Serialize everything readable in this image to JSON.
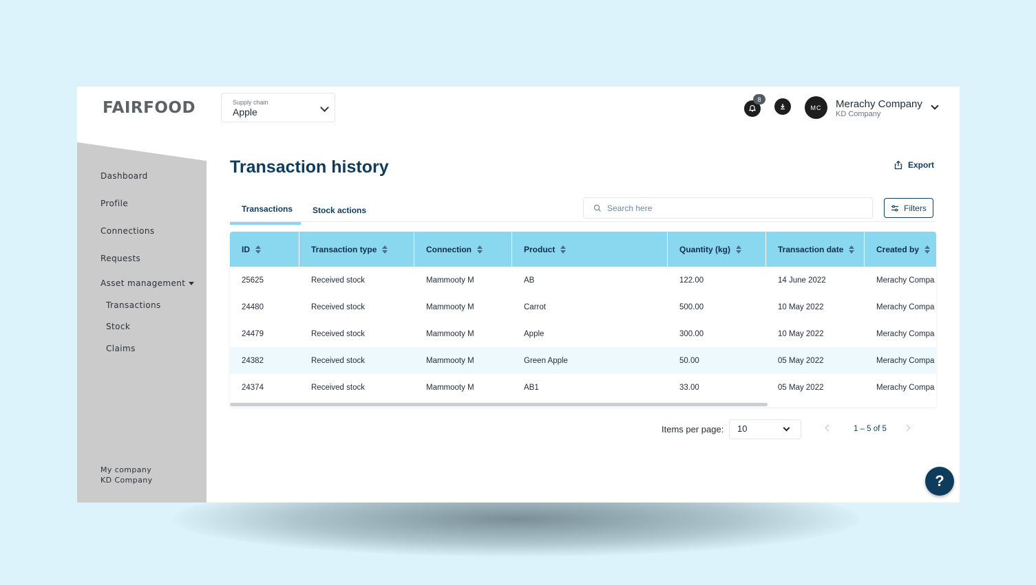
{
  "app": {
    "logo": "FAIRFOOD"
  },
  "supply_chain": {
    "label": "Supply chain",
    "value": "Apple"
  },
  "header": {
    "notification_count": "8",
    "avatar_initials": "MC",
    "user_name": "Merachy Company",
    "user_company": "KD Company"
  },
  "sidebar": {
    "items": [
      {
        "label": "Dashboard"
      },
      {
        "label": "Profile"
      },
      {
        "label": "Connections"
      },
      {
        "label": "Requests"
      },
      {
        "label": "Asset management"
      }
    ],
    "sub_items": [
      {
        "label": "Transactions"
      },
      {
        "label": "Stock"
      },
      {
        "label": "Claims"
      }
    ],
    "bottom": {
      "label": "My company",
      "company": "KD Company"
    }
  },
  "page": {
    "title": "Transaction history",
    "export_label": "Export"
  },
  "tabs": [
    {
      "label": "Transactions"
    },
    {
      "label": "Stock actions"
    }
  ],
  "search": {
    "placeholder": "Search here"
  },
  "filters_label": "Filters",
  "table": {
    "columns": [
      "ID",
      "Transaction type",
      "Connection",
      "Product",
      "Quantity (kg)",
      "Transaction date",
      "Created by"
    ],
    "rows": [
      [
        "25625",
        "Received stock",
        "Mammooty M",
        "AB",
        "122.00",
        "14 June 2022",
        "Merachy Compa"
      ],
      [
        "24480",
        "Received stock",
        "Mammooty M",
        "Carrot",
        "500.00",
        "10 May 2022",
        "Merachy Compa"
      ],
      [
        "24479",
        "Received stock",
        "Mammooty M",
        "Apple",
        "300.00",
        "10 May 2022",
        "Merachy Compa"
      ],
      [
        "24382",
        "Received stock",
        "Mammooty M",
        "Green Apple",
        "50.00",
        "05 May 2022",
        "Merachy Compa"
      ],
      [
        "24374",
        "Received stock",
        "Mammooty M",
        "AB1",
        "33.00",
        "05 May 2022",
        "Merachy Compa"
      ]
    ]
  },
  "pagination": {
    "items_per_page_label": "Items per page:",
    "items_per_page_value": "10",
    "range": "1 – 5 of 5"
  },
  "help_label": "?",
  "colors": {
    "brand_navy": "#0f3b5c",
    "header_cyan": "#8ad8f0",
    "sidebar_gray": "#cbcbcb",
    "background": "#dcf3fb"
  }
}
